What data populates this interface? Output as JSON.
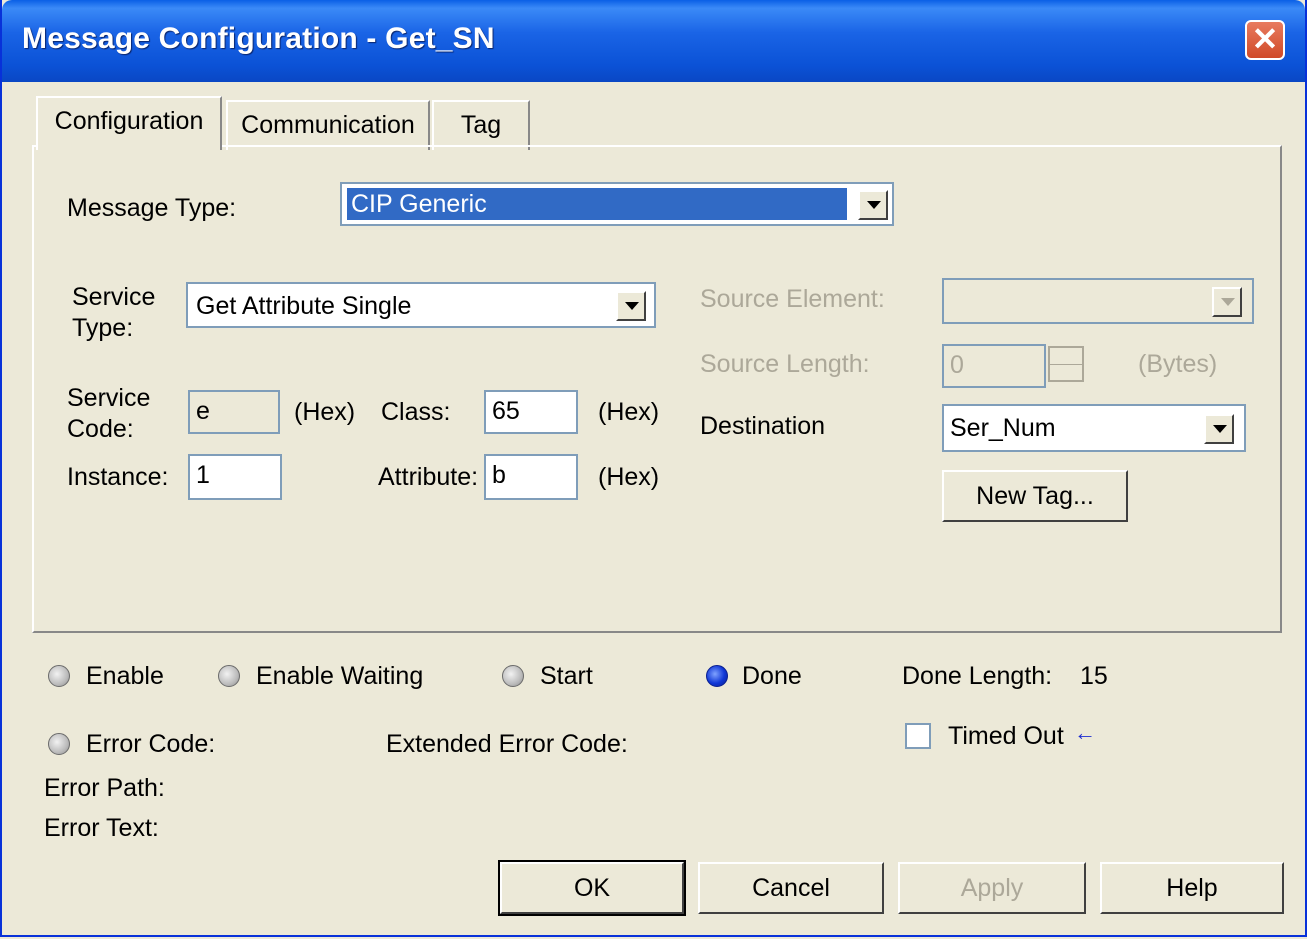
{
  "window": {
    "title": "Message Configuration - Get_SN"
  },
  "tabs": [
    {
      "label": "Configuration"
    },
    {
      "label": "Communication"
    },
    {
      "label": "Tag"
    }
  ],
  "config": {
    "message_type_label": "Message Type:",
    "message_type_value": "CIP Generic",
    "service_type_label_1": "Service",
    "service_type_label_2": "Type:",
    "service_type_value": "Get Attribute Single",
    "service_code_label_1": "Service",
    "service_code_label_2": "Code:",
    "service_code_value": "e",
    "hex_1": "(Hex)",
    "class_label": "Class:",
    "class_value": "65",
    "hex_2": "(Hex)",
    "instance_label": "Instance:",
    "instance_value": "1",
    "attribute_label": "Attribute:",
    "attribute_value": "b",
    "hex_3": "(Hex)",
    "source_element_label": "Source Element:",
    "source_element_value": "",
    "source_length_label": "Source Length:",
    "source_length_value": "0",
    "bytes_label": "(Bytes)",
    "destination_label": "Destination",
    "destination_value": "Ser_Num",
    "new_tag_label": "New Tag..."
  },
  "status": {
    "enable": "Enable",
    "enable_waiting": "Enable Waiting",
    "start": "Start",
    "done": "Done",
    "done_length_label": "Done Length:",
    "done_length_value": "15",
    "error_code": "Error Code:",
    "extended_error_code": "Extended Error Code:",
    "timed_out": "Timed Out",
    "timed_out_checked": false,
    "error_path": "Error Path:",
    "error_text": "Error Text:"
  },
  "buttons": {
    "ok": "OK",
    "cancel": "Cancel",
    "apply": "Apply",
    "help": "Help"
  },
  "colors": {
    "title_bar": "#0a5fe6",
    "selection": "#316ac5",
    "disabled_text": "#aca899",
    "done_indicator": "#1037d6"
  }
}
